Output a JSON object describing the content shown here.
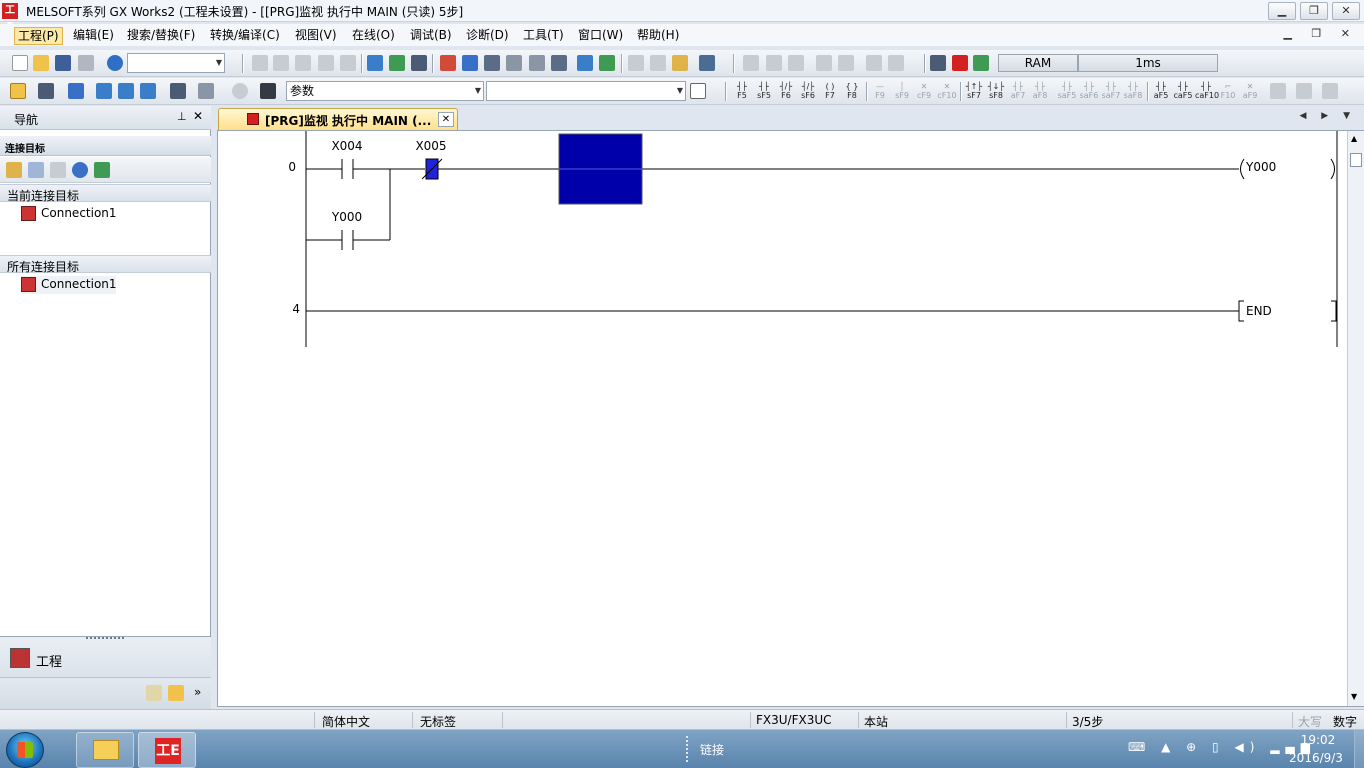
{
  "window": {
    "title": "MELSOFT系列 GX Works2 (工程未设置) - [[PRG]监视 执行中 MAIN (只读) 5步]",
    "icon": "gx-works-app-icon",
    "controls": {
      "minimize": "▁",
      "restore": "❐",
      "close": "✕"
    }
  },
  "menu": {
    "items": [
      {
        "label": "工程(P)",
        "active": true
      },
      {
        "label": "编辑(E)"
      },
      {
        "label": "搜索/替换(F)"
      },
      {
        "label": "转换/编译(C)"
      },
      {
        "label": "视图(V)"
      },
      {
        "label": "在线(O)"
      },
      {
        "label": "调试(B)"
      },
      {
        "label": "诊断(D)"
      },
      {
        "label": "工具(T)"
      },
      {
        "label": "窗口(W)"
      },
      {
        "label": "帮助(H)"
      }
    ],
    "mdi_controls": "▁ ❐ ✕"
  },
  "toolbar": {
    "ram_label": "RAM",
    "scan_time": "1ms",
    "param_combo": "参数",
    "device_combo": "",
    "blank_combo": "",
    "fkeys1": [
      "F5",
      "sF5",
      "F6",
      "sF6",
      "F7",
      "F8"
    ],
    "fkeys2": [
      "F9",
      "sF9",
      "cF9",
      "cF10"
    ],
    "fkeys3": [
      "sF7",
      "sF8",
      "aF7",
      "aF8"
    ],
    "fkeys4": [
      "saF5",
      "saF6",
      "saF7",
      "saF8"
    ],
    "fkeys5": [
      "aF5",
      "caF5",
      "caF10",
      "F10",
      "aF9"
    ]
  },
  "navigation": {
    "title": "导航",
    "pin": "⊥",
    "close": "✕",
    "section": "连接目标",
    "current_group": "当前连接目标",
    "current_items": [
      "Connection1"
    ],
    "all_group": "所有连接目标",
    "all_items": [
      "Connection1"
    ],
    "project_label": "工程",
    "more": "»"
  },
  "tab": {
    "label": "[PRG]监视 执行中 MAIN (...",
    "close": "✕",
    "nav": "◀ ▶ ▼"
  },
  "ladder": {
    "rungs": [
      {
        "step": "0",
        "contacts": [
          "X004",
          "X005"
        ],
        "branch_contact": "Y000",
        "coil": "Y000"
      },
      {
        "step": "4",
        "instruction": "END"
      }
    ]
  },
  "status": {
    "language": "简体中文",
    "label": "无标签",
    "plc_model": "FX3U/FX3UC",
    "station": "本站",
    "steps": "3/5步",
    "caps": "大写",
    "num": "数字"
  },
  "taskbar": {
    "links": "链接",
    "time": "19:02",
    "date": "2016/9/3",
    "gx_icon_text": "工E"
  },
  "colors": {
    "monitor_block": "#0000aa",
    "active_contact": "#2222dd",
    "accent_tab": "#ffe08a"
  }
}
